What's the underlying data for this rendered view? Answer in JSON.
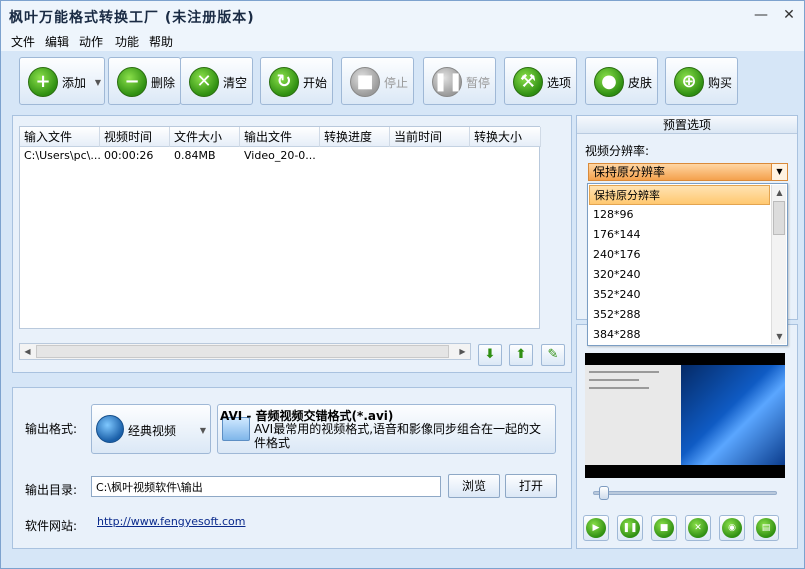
{
  "window": {
    "title": "枫叶万能格式转换工厂  (未注册版本)",
    "minimize": "—",
    "close": "✕"
  },
  "menu": [
    "文件",
    "编辑",
    "动作",
    "功能",
    "帮助"
  ],
  "toolbar": {
    "add": "添加",
    "delete": "删除",
    "clear": "清空",
    "start": "开始",
    "stop": "停止",
    "pause": "暂停",
    "options": "选项",
    "skin": "皮肤",
    "buy": "购买"
  },
  "file_list": {
    "columns": [
      "输入文件",
      "视频时间",
      "文件大小",
      "输出文件",
      "转换进度",
      "当前时间",
      "转换大小"
    ],
    "rows": [
      [
        "C:\\Users\\pc\\...",
        "00:00:26",
        "0.84MB",
        "Video_20-0...",
        "",
        "",
        ""
      ]
    ]
  },
  "output": {
    "format_label": "输出格式:",
    "format_button": "经典视频",
    "format_title": "AVI - 音频视频交错格式(*.avi)",
    "format_desc": "AVI最常用的视频格式,语音和影像同步组合在一起的文件格式",
    "dir_label": "输出目录:",
    "dir_value": "C:\\枫叶视频软件\\输出",
    "browse": "浏览",
    "open": "打开",
    "website_label": "软件网站:",
    "website_url": "http://www.fengyesoft.com"
  },
  "preset": {
    "title": "预置选项",
    "resolution_label": "视频分辨率:",
    "selected": "保持原分辨率",
    "options": [
      "保持原分辨率",
      "128*96",
      "176*144",
      "240*176",
      "320*240",
      "352*240",
      "352*288",
      "384*288"
    ]
  },
  "preview": {
    "progress": 0.05
  },
  "colors": {
    "window_bg": "#d6e6f7",
    "accent_green": "#2f8f12",
    "combo_orange": "#f4a14d"
  }
}
